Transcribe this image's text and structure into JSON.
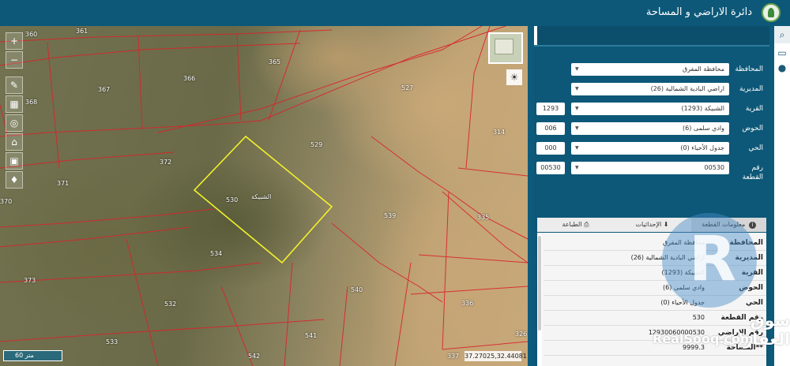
{
  "header": {
    "title": "دائرة الاراضي و المساحة"
  },
  "map_tools": [
    {
      "name": "zoom-in-button",
      "glyph": "+"
    },
    {
      "name": "zoom-out-button",
      "glyph": "−"
    },
    {
      "name": "draw-button",
      "glyph": "✎"
    },
    {
      "name": "measure-button",
      "glyph": "▦"
    },
    {
      "name": "locate-button",
      "glyph": "◎"
    },
    {
      "name": "home-button",
      "glyph": "⌂"
    },
    {
      "name": "export-button",
      "glyph": "▣"
    },
    {
      "name": "north-arrow-button",
      "glyph": "♦"
    }
  ],
  "map": {
    "parcels": [
      "360",
      "361",
      "365",
      "366",
      "367",
      "368",
      "372",
      "371",
      "370",
      "530",
      "529",
      "527",
      "314",
      "539",
      "335",
      "534",
      "373",
      "532",
      "540",
      "336",
      "533",
      "541",
      "542",
      "337",
      "326"
    ],
    "selected_parcel_label": "الشبيكة",
    "scale_text": "60 متر",
    "coordinates": "37.27025,32.44081"
  },
  "search_form": {
    "governorate": {
      "label": "المحافظة",
      "value": "محافظة المفرق"
    },
    "directorate": {
      "label": "المديرية",
      "value": "اراضي البادية الشمالية (26)"
    },
    "village": {
      "label": "القرية",
      "value": "الشبيكة (1293)",
      "code": "1293"
    },
    "basin": {
      "label": "الحوض",
      "value": "وادي سلمى (6)",
      "code": "006"
    },
    "neighborhood": {
      "label": "الحي",
      "value": "جدول الأحياء (0)",
      "code": "000"
    },
    "parcel": {
      "label": "رقم القطعة",
      "value": "00530",
      "code": "00530"
    }
  },
  "tabs": [
    {
      "label": "معلومات القطعة",
      "icon": "i"
    },
    {
      "label": "الإحداثيات",
      "icon": "⬇"
    },
    {
      "label": "الطباعة",
      "icon": "⎙"
    }
  ],
  "info_rows": [
    {
      "key": "المحافظة",
      "value": "محافظة المفرق"
    },
    {
      "key": "المديرية",
      "value": "اراضي البادية الشمالية (26)"
    },
    {
      "key": "القرية",
      "value": "الشبيكة (1293)"
    },
    {
      "key": "الحوض",
      "value": "وادي سلمى (6)"
    },
    {
      "key": "الحي",
      "value": "جدول الأحياء (0)"
    },
    {
      "key": "رقم القطعة",
      "value": "530"
    },
    {
      "key": "رقم الاراضي",
      "value": "12930060000530"
    },
    {
      "key": "**المساحة",
      "value": "9999.3"
    }
  ],
  "side_icons": [
    "search-icon",
    "folder-icon",
    "location-pin-icon"
  ],
  "watermark": {
    "arabic": "سوق العقارات",
    "english": "RealSooq.com"
  }
}
